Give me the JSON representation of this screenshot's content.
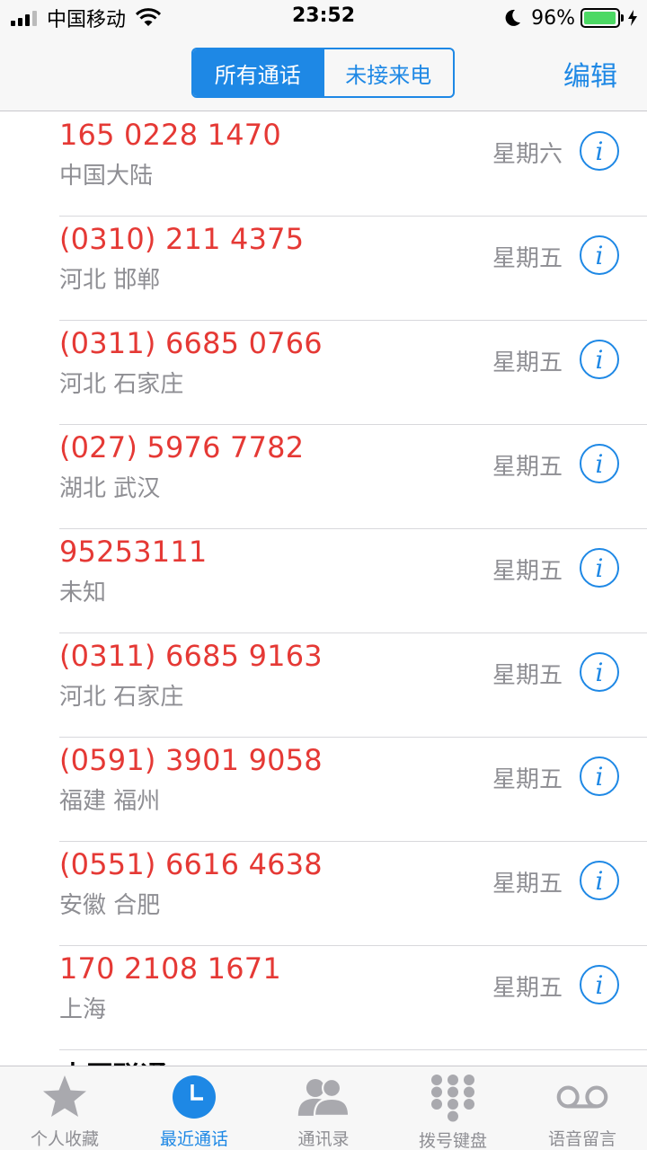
{
  "status_bar": {
    "carrier": "中国移动",
    "time": "23:52",
    "battery": "96%",
    "battery_level": 0.96
  },
  "nav": {
    "segments": [
      "所有通话",
      "未接来电"
    ],
    "active_segment": 0,
    "edit_label": "编辑"
  },
  "calls": [
    {
      "number": "165 0228 1470",
      "location": "中国大陆",
      "day": "星期六"
    },
    {
      "number": "(0310) 211 4375",
      "location": "河北 邯郸",
      "day": "星期五"
    },
    {
      "number": "(0311) 6685 0766",
      "location": "河北 石家庄",
      "day": "星期五"
    },
    {
      "number": "(027) 5976 7782",
      "location": "湖北 武汉",
      "day": "星期五"
    },
    {
      "number": "95253111",
      "location": "未知",
      "day": "星期五"
    },
    {
      "number": "(0311) 6685 9163",
      "location": "河北 石家庄",
      "day": "星期五"
    },
    {
      "number": "(0591) 3901 9058",
      "location": "福建 福州",
      "day": "星期五"
    },
    {
      "number": "(0551) 6616 4638",
      "location": "安徽 合肥",
      "day": "星期五"
    },
    {
      "number": "170 2108 1671",
      "location": "上海",
      "day": "星期五"
    }
  ],
  "info_glyph": "i",
  "partial_row_text": "中国联通",
  "tabs": [
    {
      "label": "个人收藏",
      "icon": "star-icon"
    },
    {
      "label": "最近通话",
      "icon": "clock-icon"
    },
    {
      "label": "通讯录",
      "icon": "contacts-icon"
    },
    {
      "label": "拨号键盘",
      "icon": "keypad-icon"
    },
    {
      "label": "语音留言",
      "icon": "voicemail-icon"
    }
  ],
  "active_tab": 1,
  "colors": {
    "accent": "#1e88e5",
    "missed_call": "#e53935",
    "secondary_text": "#8e8e93",
    "inactive_icon": "#a9a9ae"
  }
}
